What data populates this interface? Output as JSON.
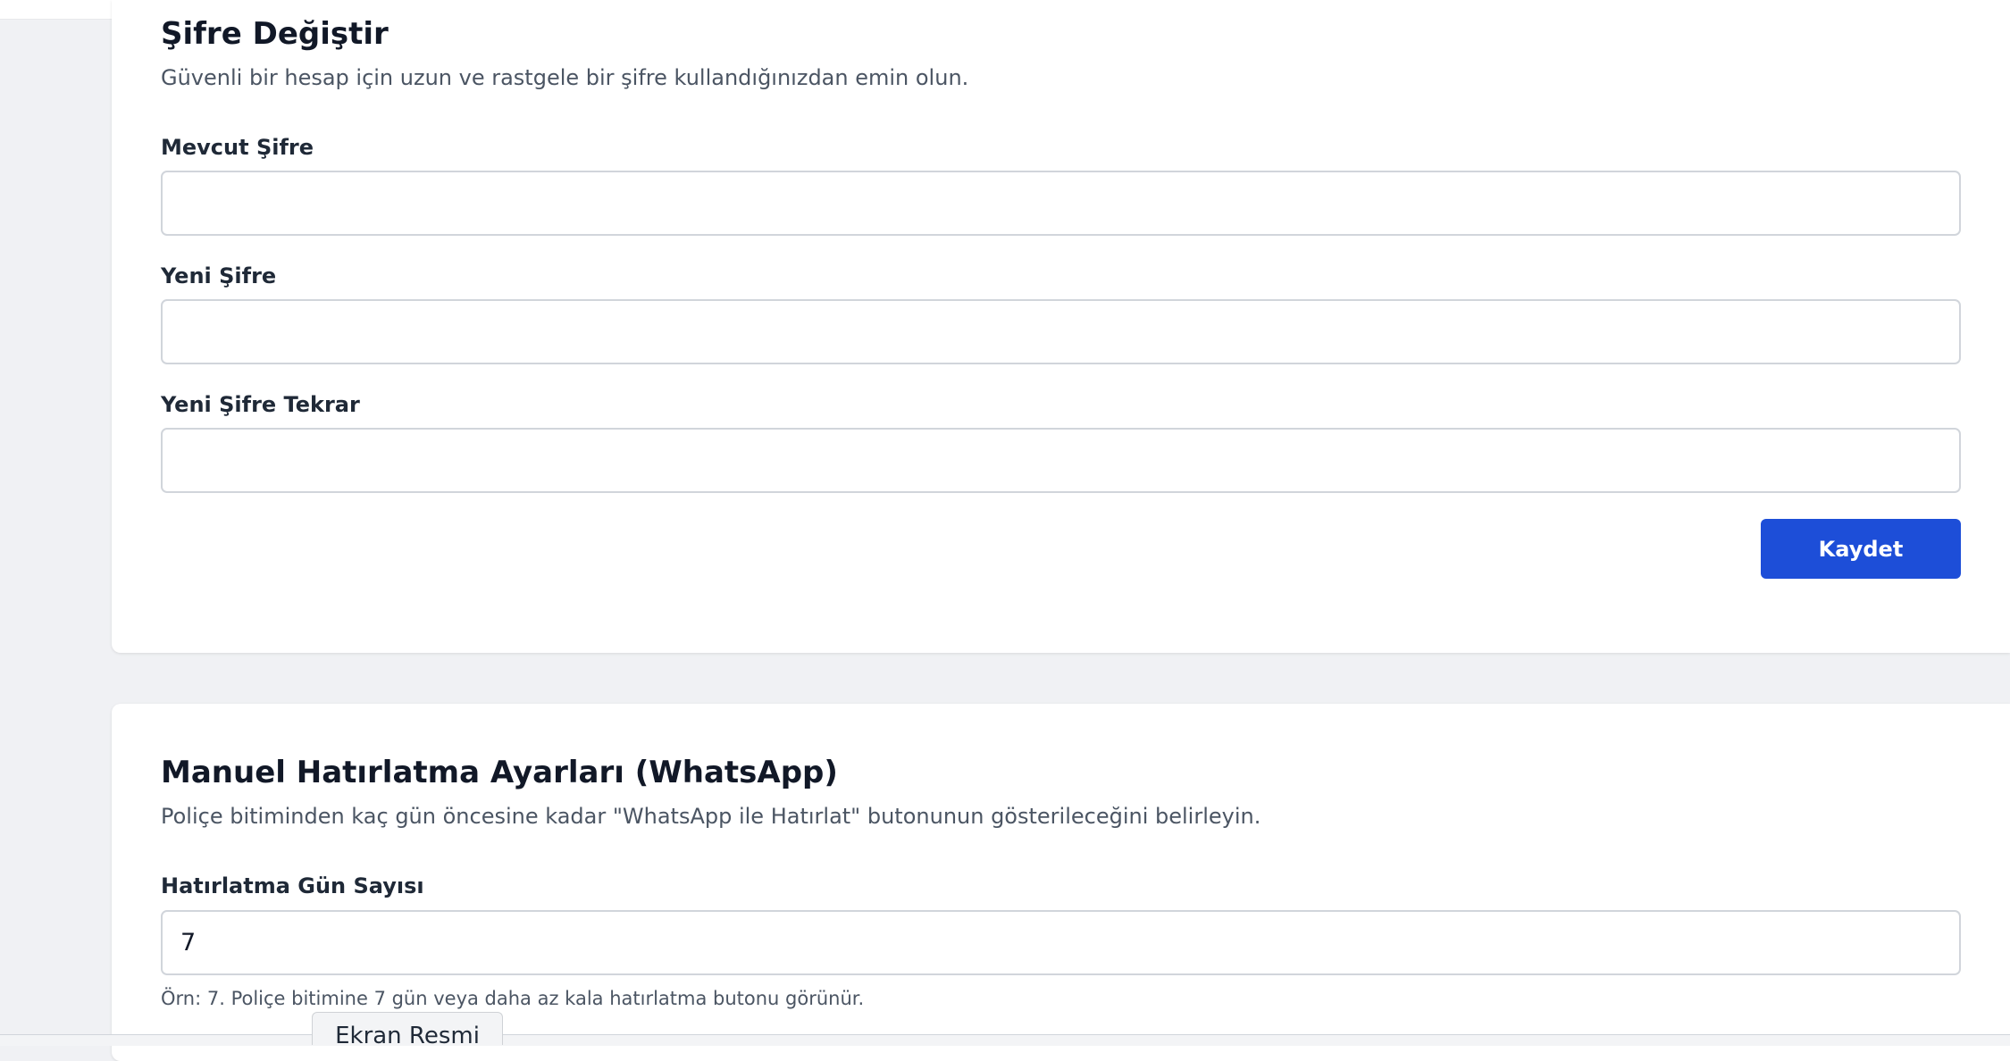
{
  "password_section": {
    "title": "Şifre Değiştir",
    "description": "Güvenli bir hesap için uzun ve rastgele bir şifre kullandığınızdan emin olun.",
    "fields": [
      {
        "label": "Mevcut Şifre",
        "value": ""
      },
      {
        "label": "Yeni Şifre",
        "value": ""
      },
      {
        "label": "Yeni Şifre Tekrar",
        "value": ""
      }
    ],
    "save_label": "Kaydet"
  },
  "reminder_section": {
    "title": "Manuel Hatırlatma Ayarları (WhatsApp)",
    "description": "Poliçe bitiminden kaç gün öncesine kadar \"WhatsApp ile Hatırlat\" butonunun gösterileceğini belirleyin.",
    "field_label": "Hatırlatma Gün Sayısı",
    "field_value": "7",
    "hint": "Örn: 7. Poliçe bitimine 7 gün veya daha az kala hatırlatma butonu görünür."
  },
  "tooltip": {
    "text": "Ekran Resmi"
  },
  "colors": {
    "accent": "#1d4ed8",
    "background": "#f0f1f4"
  }
}
